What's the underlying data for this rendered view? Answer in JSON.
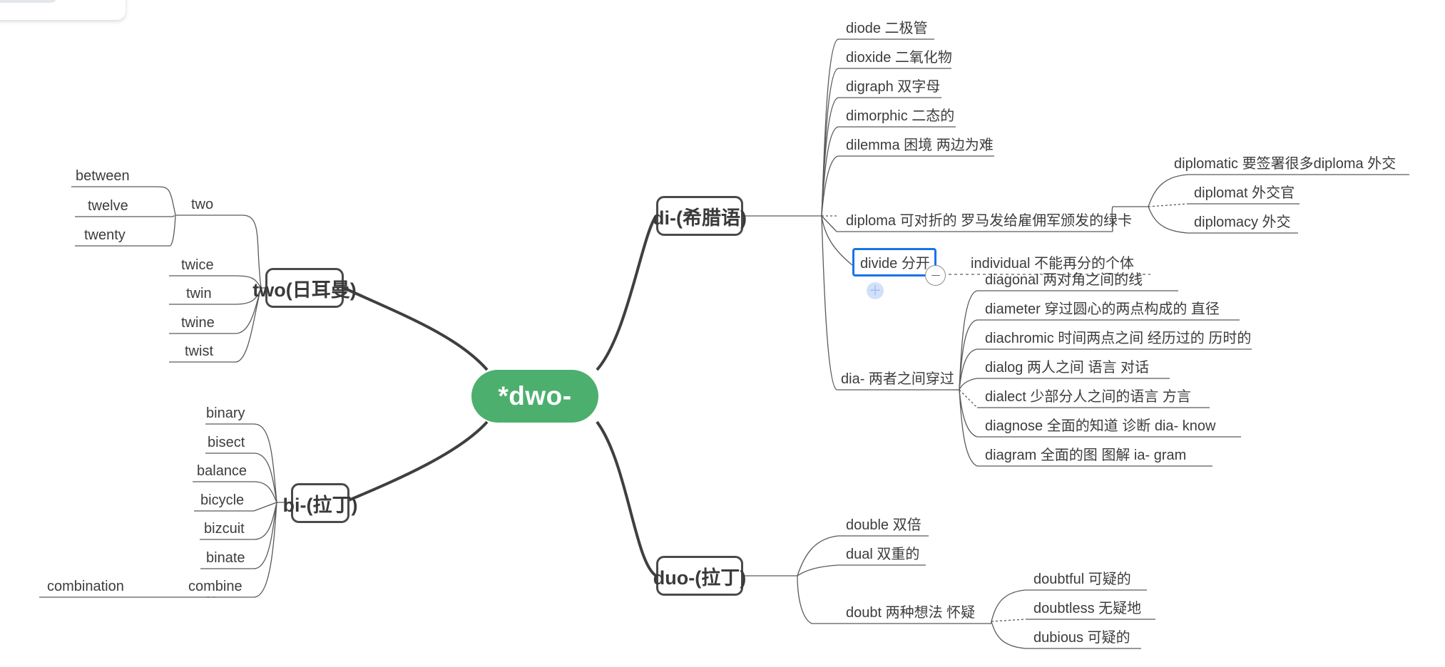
{
  "app": {
    "toolbar_visible": true
  },
  "colors": {
    "root_fill": "#4caf6e",
    "root_text": "#ffffff",
    "branch_border": "#4a4a4a",
    "edge": "#5a5a5a",
    "leaf_text": "#3c3c3c",
    "selection": "#1a73e8",
    "add_button": "#d2e1fa"
  },
  "mindmap": {
    "root": {
      "label": "*dwo-"
    },
    "branches": [
      {
        "id": "two-germanic",
        "label": "two(日耳曼)",
        "side": "left",
        "children": [
          {
            "label": "two",
            "children": [
              {
                "label": "between"
              },
              {
                "label": "twelve"
              },
              {
                "label": "twenty"
              }
            ]
          },
          {
            "label": "twice"
          },
          {
            "label": "twin"
          },
          {
            "label": "twine"
          },
          {
            "label": "twist"
          }
        ]
      },
      {
        "id": "bi-latin",
        "label": "bi-(拉丁)",
        "side": "left",
        "children": [
          {
            "label": "binary"
          },
          {
            "label": "bisect"
          },
          {
            "label": "balance"
          },
          {
            "label": "bicycle"
          },
          {
            "label": "bizcuit"
          },
          {
            "label": "binate"
          },
          {
            "label": "combine",
            "children": [
              {
                "label": "combination"
              }
            ]
          }
        ]
      },
      {
        "id": "di-greek",
        "label": "di-(希腊语)",
        "side": "right",
        "children": [
          {
            "label": "diode 二极管"
          },
          {
            "label": "dioxide 二氧化物"
          },
          {
            "label": "digraph 双字母"
          },
          {
            "label": "dimorphic 二态的"
          },
          {
            "label": "dilemma  困境 两边为难"
          },
          {
            "label": "diploma 可对折的 罗马发给雇佣军颁发的绿卡",
            "children": [
              {
                "label": "diplomatic 要签署很多diploma 外交"
              },
              {
                "label": "diplomat 外交官"
              },
              {
                "label": "diplomacy 外交"
              }
            ]
          },
          {
            "label": "divide 分开",
            "selected": true,
            "collapsed_toggle": "minus",
            "children": [
              {
                "label": "individual 不能再分的个体"
              }
            ]
          },
          {
            "label": "dia- 两者之间穿过",
            "children": [
              {
                "label": "diagonal 两对角之间的线"
              },
              {
                "label": "diameter 穿过圆心的两点构成的 直径"
              },
              {
                "label": "diachromic 时间两点之间 经历过的 历时的"
              },
              {
                "label": "dialog 两人之间 语言 对话"
              },
              {
                "label": "dialect 少部分人之间的语言 方言"
              },
              {
                "label": "diagnose 全面的知道 诊断  dia- know"
              },
              {
                "label": "diagram 全面的图 图解  ia- gram"
              }
            ]
          }
        ]
      },
      {
        "id": "duo-latin",
        "label": "duo-(拉丁)",
        "side": "right",
        "children": [
          {
            "label": "double 双倍"
          },
          {
            "label": "dual 双重的"
          },
          {
            "label": "doubt 两种想法 怀疑",
            "children": [
              {
                "label": "doubtful 可疑的"
              },
              {
                "label": "doubtless 无疑地"
              },
              {
                "label": "dubious 可疑的"
              }
            ]
          }
        ]
      }
    ]
  }
}
